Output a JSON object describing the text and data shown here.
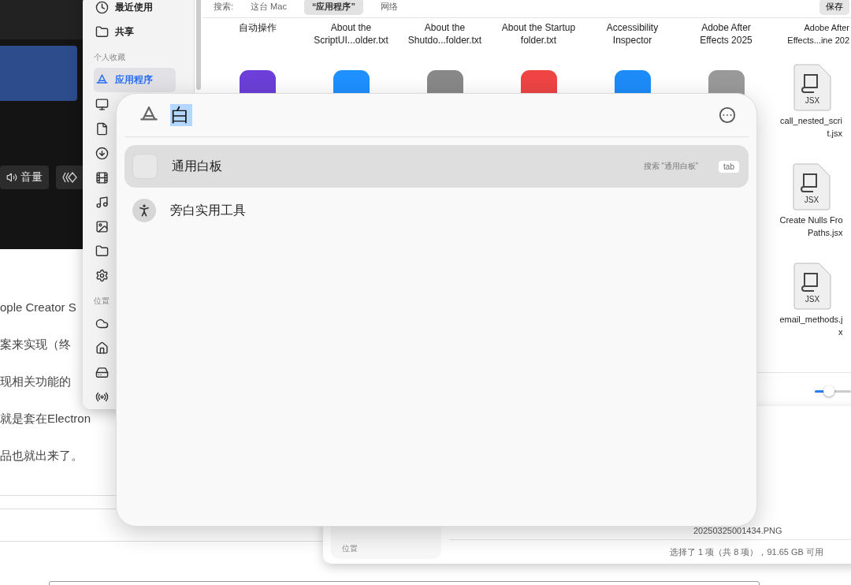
{
  "player": {
    "buttons": [
      {
        "kind": "volume",
        "label": "音量"
      },
      {
        "kind": "effects"
      }
    ]
  },
  "article": {
    "lines": [
      "ople Creator S",
      "案来实现（终",
      "现相关功能的",
      "就是套在Electron",
      "品也就出来了。"
    ]
  },
  "finder": {
    "sidebar": [
      {
        "kind": "item",
        "label": "最近使用",
        "selected": false
      },
      {
        "kind": "item",
        "label": "共享",
        "selected": false
      },
      {
        "kind": "header",
        "label": "个人收藏"
      },
      {
        "kind": "item",
        "label": "应用程序",
        "selected": true
      },
      {
        "kind": "item",
        "selected": false
      },
      {
        "kind": "item",
        "selected": false
      },
      {
        "kind": "item",
        "selected": false
      },
      {
        "kind": "item",
        "selected": false
      },
      {
        "kind": "item",
        "selected": false
      },
      {
        "kind": "item",
        "selected": false
      },
      {
        "kind": "item",
        "selected": false
      },
      {
        "kind": "item",
        "selected": false
      },
      {
        "kind": "header",
        "label": "位置"
      },
      {
        "kind": "item",
        "selected": false
      },
      {
        "kind": "item",
        "selected": false
      },
      {
        "kind": "item",
        "selected": false
      },
      {
        "kind": "item",
        "selected": false
      }
    ],
    "search": {
      "label": "搜索:",
      "scopes": [
        {
          "label": "这台 Mac",
          "selected": false
        },
        {
          "label": "“应用程序”",
          "selected": true
        },
        {
          "label": "网络",
          "selected": false
        }
      ],
      "save": "保存"
    },
    "top_labels": [
      [
        "自动操作"
      ],
      [
        "About the",
        "ScriptUI...older.txt"
      ],
      [
        "About the",
        "Shutdo...folder.txt"
      ],
      [
        "About the Startup",
        "folder.txt"
      ],
      [
        "Accessibility",
        "Inspector"
      ],
      [
        "Adobe After",
        "Effects 2025"
      ],
      [
        "Adobe After",
        "Effects...ine 202"
      ]
    ],
    "files": [
      {
        "badge": "JSX",
        "lines": [
          "call_nested_scri",
          "t.jsx"
        ]
      },
      {
        "badge": "JSX",
        "lines": [
          "Create Nulls Fro",
          "Paths.jsx"
        ]
      },
      {
        "badge": "JSX",
        "lines": [
          "email_methods.j",
          "x"
        ]
      }
    ],
    "icon_size_slider": {
      "level": 0.4
    }
  },
  "spotlight": {
    "query": "白",
    "results": [
      {
        "label": "通用白板",
        "selected": true,
        "hint": "搜索 “通用白板”",
        "key": "tab"
      },
      {
        "label": "旁白实用工具",
        "selected": false
      }
    ]
  },
  "back_finder": {
    "path_item": "20250325001434.PNG",
    "status": "选择了 1 项（共 8 项），91.65 GB 可用",
    "sidebar_header": "位置"
  }
}
